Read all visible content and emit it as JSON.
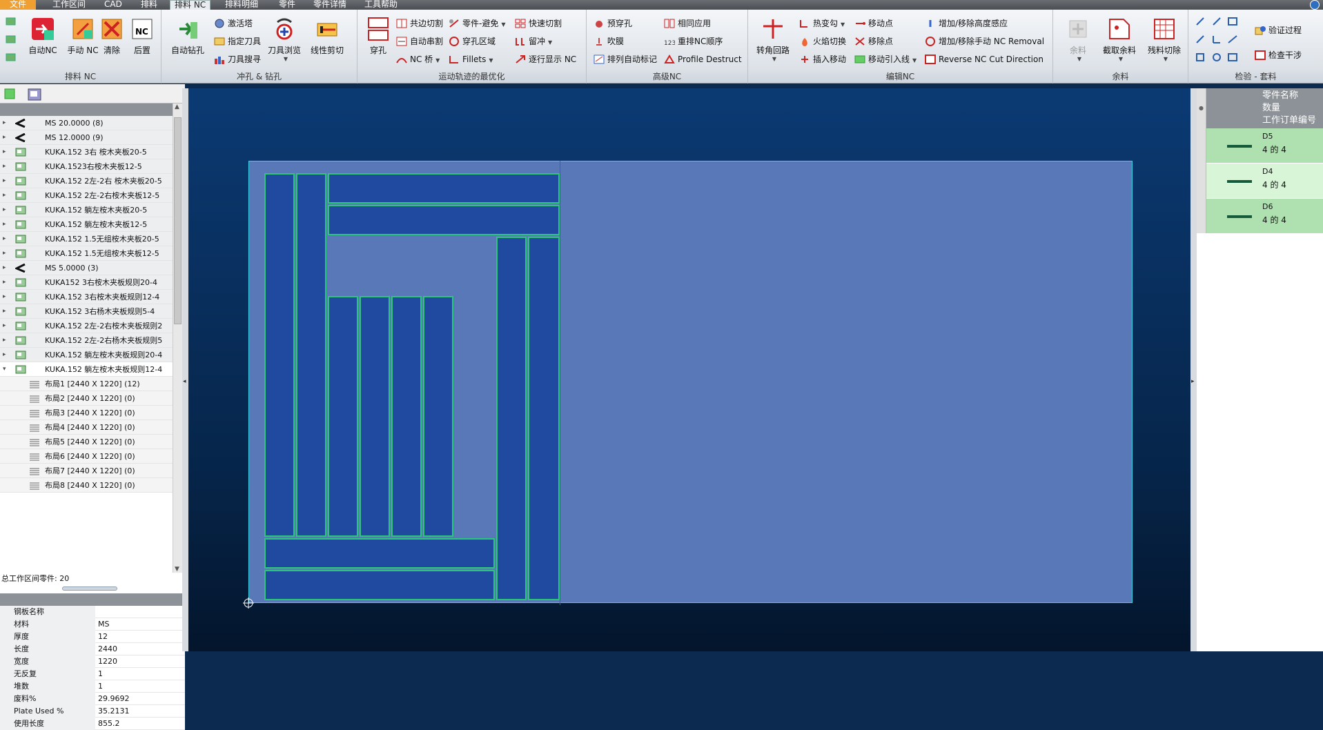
{
  "menubar": {
    "items": [
      "文件",
      "工作区间",
      "CAD",
      "排料",
      "排料 NC",
      "排料明细",
      "零件",
      "零件详情",
      "工具帮助"
    ]
  },
  "ribbon": {
    "groups": {
      "nest_nc": {
        "title": "排料 NC",
        "auto_nc": "自动NC",
        "manual_nc": "手动\nNC",
        "clear": "清除",
        "post": "后置"
      },
      "punch_drill": {
        "title": "冲孔 & 钻孔",
        "auto_drill": "自动钻孔",
        "activate_tower": "激活塔",
        "assign_tool": "指定刀具",
        "tool_search": "刀具搜寻",
        "tool_browse": "刀具浏览",
        "line_cut": "线性剪切"
      },
      "motion_opt": {
        "title": "运动轨迹的最优化",
        "pierce": "穿孔",
        "common_cut": "共边切割",
        "auto_chain": "自动串割",
        "nc_bridge": "NC 桥",
        "part_avoid": "零件-避免",
        "pierce_area": "穿孔区域",
        "fillets": "Fillets",
        "fast_cut": "快速切割",
        "micro_joint": "留冲",
        "step_show": "逐行显示 NC"
      },
      "advanced_nc": {
        "title": "高级NC",
        "pre_pierce": "预穿孔",
        "blow_film": "吹膜",
        "auto_mark": "排列自动标记",
        "same_apply": "相同应用",
        "reorder_nc": "重排NC顺序",
        "profile_destruct": "Profile Destruct"
      },
      "edit_nc": {
        "title": "编辑NC",
        "corner_loop": "转角回路",
        "hot_key": "热变勾",
        "flame_cut": "火焰切换",
        "insert_move": "插入移动",
        "move_point": "移动点",
        "remove_point": "移除点",
        "move_leadin": "移动引入线",
        "height_sense": "增加/移除高度感应",
        "manual_nc_removal": "增加/移除手动 NC Removal",
        "reverse_nc": "Reverse NC Cut Direction"
      },
      "remnant": {
        "title": "余料",
        "remnant": "余料",
        "cut_remnant": "截取余料",
        "scrap_cut": "残料切除"
      },
      "inspect": {
        "title": "检验 - 套料",
        "verify": "验证过程",
        "check_interfere": "检查干涉"
      }
    }
  },
  "tree": {
    "rows": [
      {
        "label": "MS 20.0000 (8)",
        "type": "material",
        "exp": "▸"
      },
      {
        "label": "MS 12.0000 (9)",
        "type": "material",
        "exp": "▸"
      },
      {
        "label": "KUKA.152 3右 桉木夹板20-5",
        "type": "nest",
        "exp": "▸"
      },
      {
        "label": "KUKA.1523右桉木夹板12-5",
        "type": "nest",
        "exp": "▸"
      },
      {
        "label": "KUKA.152 2左-2右 桉木夹板20-5",
        "type": "nest",
        "exp": "▸"
      },
      {
        "label": "KUKA.152  2左-2右桉木夹板12-5",
        "type": "nest",
        "exp": "▸"
      },
      {
        "label": "KUKA.152  躺左桉木夹板20-5",
        "type": "nest",
        "exp": "▸"
      },
      {
        "label": "KUKA.152  躺左桉木夹板12-5",
        "type": "nest",
        "exp": "▸"
      },
      {
        "label": "KUKA.152  1.5无组桉木夹板20-5",
        "type": "nest",
        "exp": "▸"
      },
      {
        "label": "KUKA.152  1.5无组桉木夹板12-5",
        "type": "nest",
        "exp": "▸"
      },
      {
        "label": "MS 5.0000 (3)",
        "type": "material",
        "exp": "▸"
      },
      {
        "label": "KUKA152 3右桉木夹板规则20-4",
        "type": "nest",
        "exp": "▸"
      },
      {
        "label": "KUKA.152  3右桉木夹板规则12-4",
        "type": "nest",
        "exp": "▸"
      },
      {
        "label": "KUKA.152  3右杨木夹板规则5-4",
        "type": "nest",
        "exp": "▸"
      },
      {
        "label": "KUKA.152  2左-2右桉木夹板规则2",
        "type": "nest",
        "exp": "▸"
      },
      {
        "label": "KUKA.152  2左-2右杨木夹板规则5",
        "type": "nest",
        "exp": "▸"
      },
      {
        "label": "KUKA.152  躺左桉木夹板规则20-4",
        "type": "nest",
        "exp": "▸"
      },
      {
        "label": "KUKA.152  躺左桉木夹板规则12-4",
        "type": "nest",
        "exp": "▾"
      },
      {
        "label": "布局1 [2440 X 1220]  (12)",
        "type": "layout",
        "exp": ""
      },
      {
        "label": "布局2 [2440 X 1220]  (0)",
        "type": "layout",
        "exp": ""
      },
      {
        "label": "布局3 [2440 X 1220]  (0)",
        "type": "layout",
        "exp": ""
      },
      {
        "label": "布局4 [2440 X 1220]  (0)",
        "type": "layout",
        "exp": ""
      },
      {
        "label": "布局5 [2440 X 1220]  (0)",
        "type": "layout",
        "exp": ""
      },
      {
        "label": "布局6 [2440 X 1220]  (0)",
        "type": "layout",
        "exp": ""
      },
      {
        "label": "布局7 [2440 X 1220]  (0)",
        "type": "layout",
        "exp": ""
      },
      {
        "label": "布局8 [2440 X 1220]  (0)",
        "type": "layout",
        "exp": ""
      }
    ],
    "selected_index": 17
  },
  "summary": "总工作区间零件: 20",
  "props": [
    {
      "k": "钢板名称",
      "v": ""
    },
    {
      "k": "材料",
      "v": "MS"
    },
    {
      "k": "厚度",
      "v": "12"
    },
    {
      "k": "长度",
      "v": "2440"
    },
    {
      "k": "宽度",
      "v": "1220"
    },
    {
      "k": "无反复",
      "v": "1"
    },
    {
      "k": "堆数",
      "v": "1"
    },
    {
      "k": "废料%",
      "v": "29.9692"
    },
    {
      "k": "Plate Used %",
      "v": "35.2131"
    },
    {
      "k": "使用长度",
      "v": "855.2"
    }
  ],
  "right_panel": {
    "headers": [
      "零件名称",
      "数量",
      "工作订单编号"
    ],
    "rows": [
      {
        "name": "D5",
        "qty": "4 的 4"
      },
      {
        "name": "D4",
        "qty": "4 的 4"
      },
      {
        "name": "D6",
        "qty": "4 的 4"
      }
    ]
  },
  "colors": {
    "plate": "#5878b8",
    "part": "#1f4aa0",
    "part_border": "#28c878",
    "canvas": "#0b3a73",
    "accent": "#f0a030"
  }
}
